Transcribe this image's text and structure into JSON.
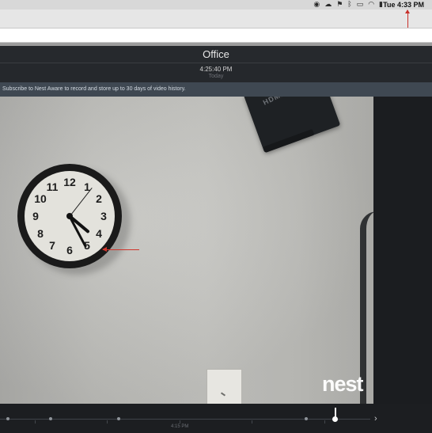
{
  "menubar": {
    "icons": [
      "shield-icon",
      "cloud-icon",
      "flag-icon",
      "bluetooth-icon",
      "airplay-icon",
      "wifi-icon",
      "battery-icon"
    ],
    "clock": "Tue 4:33 PM"
  },
  "camera": {
    "name": "Office",
    "live_time": "4:25:40 PM",
    "live_day": "Today"
  },
  "banner": {
    "text": "Subscribe to Nest Aware to record and store up to 30 days of video history."
  },
  "video": {
    "monitor_label": "HDMI",
    "clock_numbers": [
      "12",
      "1",
      "2",
      "3",
      "4",
      "5",
      "6",
      "7",
      "8",
      "9",
      "10",
      "11"
    ],
    "watermark": "nest"
  },
  "timeline": {
    "label": "4:15 PM",
    "next": "›"
  },
  "colors": {
    "annotation_arrow": "#d0352c",
    "banner_bg": "#3f4852",
    "panel_bg": "#26292d"
  }
}
